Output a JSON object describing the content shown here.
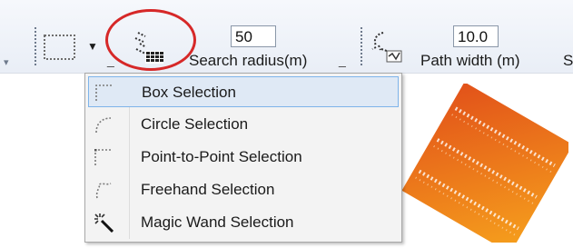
{
  "toolbar": {
    "search_radius": {
      "value": "50",
      "label": "Search radius(m)"
    },
    "path_width": {
      "value": "10.0",
      "label": "Path width (m)"
    },
    "truncated_label": "S"
  },
  "selection_menu": {
    "items": [
      {
        "label": "Box Selection",
        "icon": "box-selection-icon",
        "selected": true
      },
      {
        "label": "Circle Selection",
        "icon": "circle-selection-icon",
        "selected": false
      },
      {
        "label": "Point-to-Point Selection",
        "icon": "point-to-point-selection-icon",
        "selected": false
      },
      {
        "label": "Freehand Selection",
        "icon": "freehand-selection-icon",
        "selected": false
      },
      {
        "label": "Magic Wand Selection",
        "icon": "magic-wand-icon",
        "selected": false
      }
    ]
  },
  "colors": {
    "highlight_circle": "#d62828",
    "menu_selected_bg": "#dfe9f5",
    "menu_selected_border": "#7eb4ea",
    "raster_start": "#e9601c",
    "raster_end": "#f59a1c"
  }
}
